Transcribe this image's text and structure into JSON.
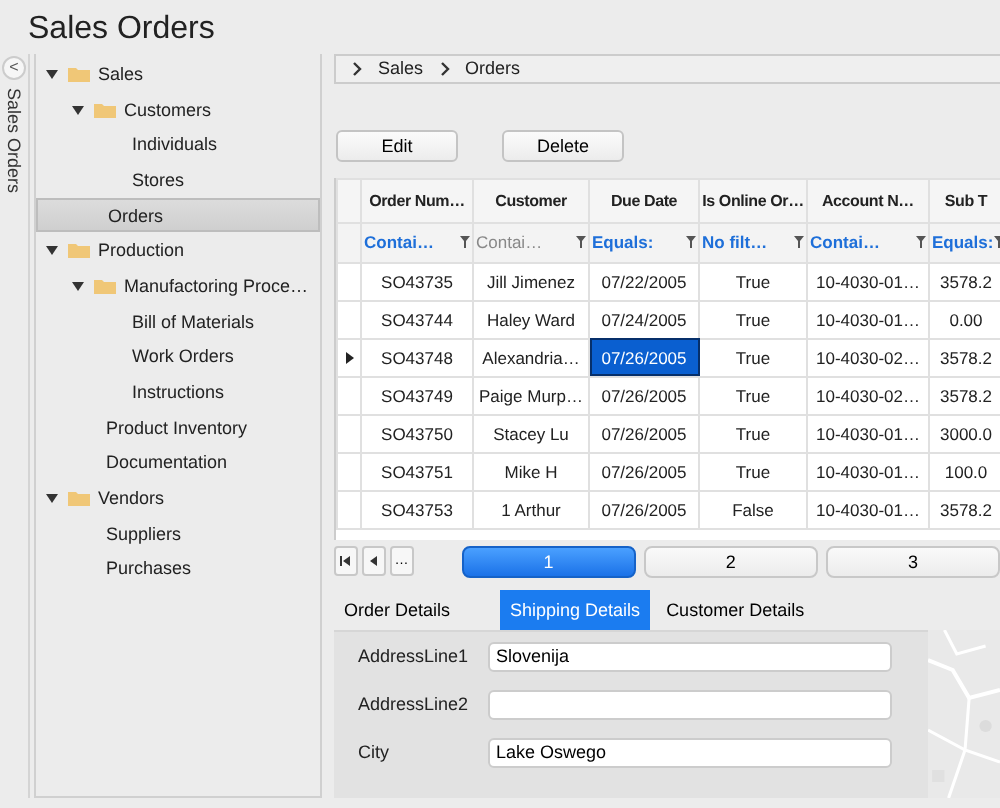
{
  "window": {
    "title": "Sales Orders"
  },
  "side_strip": {
    "collapse_label": "<",
    "title": "Sales Orders"
  },
  "tree": [
    {
      "label": "Sales",
      "expanded": true,
      "selected": false,
      "children": [
        {
          "label": "Customers",
          "expanded": true,
          "selected": false,
          "children": [
            {
              "label": "Individuals",
              "selected": false
            },
            {
              "label": "Stores",
              "selected": false
            }
          ]
        },
        {
          "label": "Orders",
          "selected": true
        }
      ]
    },
    {
      "label": "Production",
      "expanded": true,
      "selected": false,
      "children": [
        {
          "label": "Manufactoring  Proce…",
          "expanded": true,
          "selected": false,
          "children": [
            {
              "label": "Bill of Materials",
              "selected": false
            },
            {
              "label": "Work Orders",
              "selected": false
            },
            {
              "label": "Instructions",
              "selected": false
            }
          ]
        },
        {
          "label": "Product Inventory",
          "selected": false
        },
        {
          "label": "Documentation",
          "selected": false
        }
      ]
    },
    {
      "label": "Vendors",
      "expanded": true,
      "selected": false,
      "children": [
        {
          "label": "Suppliers",
          "selected": false
        },
        {
          "label": "Purchases",
          "selected": false
        }
      ]
    }
  ],
  "breadcrumb": [
    "Sales",
    "Orders"
  ],
  "buttons": [
    "Edit",
    "Delete"
  ],
  "table": {
    "columns": [
      {
        "header": "Order Num…",
        "filter": "Contai…",
        "filter_active": true
      },
      {
        "header": "Customer",
        "filter": "Contai…",
        "filter_active": false
      },
      {
        "header": "Due Date",
        "filter": "Equals:",
        "filter_active": true
      },
      {
        "header": "Is Online Or…",
        "filter": "No filt…",
        "filter_active": true
      },
      {
        "header": "Account N…",
        "filter": "Contai…",
        "filter_active": true
      },
      {
        "header": "Sub T",
        "filter": "Equals:",
        "filter_active": true
      }
    ],
    "rows": [
      {
        "selected": false,
        "cells": [
          {
            "text": "SO43735",
            "selected": false
          },
          {
            "text": "Jill Jimenez",
            "selected": false
          },
          {
            "text": "07/22/2005",
            "selected": false
          },
          {
            "text": "True",
            "selected": false
          },
          {
            "text": "10-4030-01…",
            "selected": false
          },
          {
            "text": "3578.2",
            "selected": false
          }
        ]
      },
      {
        "selected": false,
        "cells": [
          {
            "text": "SO43744",
            "selected": false
          },
          {
            "text": "Haley Ward",
            "selected": false
          },
          {
            "text": "07/24/2005",
            "selected": false
          },
          {
            "text": "True",
            "selected": false
          },
          {
            "text": "10-4030-01…",
            "selected": false
          },
          {
            "text": "0.00",
            "selected": false
          }
        ]
      },
      {
        "selected": true,
        "cells": [
          {
            "text": "SO43748",
            "selected": false
          },
          {
            "text": "Alexandria…",
            "selected": false
          },
          {
            "text": "07/26/2005",
            "selected": true
          },
          {
            "text": "True",
            "selected": false
          },
          {
            "text": "10-4030-02…",
            "selected": false
          },
          {
            "text": "3578.2",
            "selected": false
          }
        ]
      },
      {
        "selected": false,
        "cells": [
          {
            "text": "SO43749",
            "selected": false
          },
          {
            "text": "Paige  Murp…",
            "selected": false
          },
          {
            "text": "07/26/2005",
            "selected": false
          },
          {
            "text": "True",
            "selected": false
          },
          {
            "text": "10-4030-02…",
            "selected": false
          },
          {
            "text": "3578.2",
            "selected": false
          }
        ]
      },
      {
        "selected": false,
        "cells": [
          {
            "text": "SO43750",
            "selected": false
          },
          {
            "text": "Stacey Lu",
            "selected": false
          },
          {
            "text": "07/26/2005",
            "selected": false
          },
          {
            "text": "True",
            "selected": false
          },
          {
            "text": "10-4030-01…",
            "selected": false
          },
          {
            "text": "3000.0",
            "selected": false
          }
        ]
      },
      {
        "selected": false,
        "cells": [
          {
            "text": "SO43751",
            "selected": false
          },
          {
            "text": "Mike H",
            "selected": false
          },
          {
            "text": "07/26/2005",
            "selected": false
          },
          {
            "text": "True",
            "selected": false
          },
          {
            "text": "10-4030-01…",
            "selected": false
          },
          {
            "text": "100.0",
            "selected": false
          }
        ]
      },
      {
        "selected": false,
        "cells": [
          {
            "text": "SO43753",
            "selected": false
          },
          {
            "text": "1 Arthur",
            "selected": false
          },
          {
            "text": "07/26/2005",
            "selected": false
          },
          {
            "text": "False",
            "selected": false
          },
          {
            "text": "10-4030-01…",
            "selected": false
          },
          {
            "text": "3578.2",
            "selected": false
          }
        ]
      }
    ]
  },
  "pager": {
    "nav": [
      "…"
    ],
    "pages": [
      {
        "label": "1",
        "selected": true
      },
      {
        "label": "2",
        "selected": false
      },
      {
        "label": "3",
        "selected": false
      }
    ]
  },
  "detail_tabs": [
    {
      "label": "Order Details",
      "selected": false
    },
    {
      "label": "Shipping Details",
      "selected": true
    },
    {
      "label": "Customer Details",
      "selected": false
    }
  ],
  "shipping_form": [
    {
      "label": "AddressLine1",
      "value": "Slovenija"
    },
    {
      "label": "AddressLine2"
    },
    {
      "label": "City",
      "value": "Lake Oswego"
    }
  ],
  "map": {
    "kind": "picture"
  }
}
